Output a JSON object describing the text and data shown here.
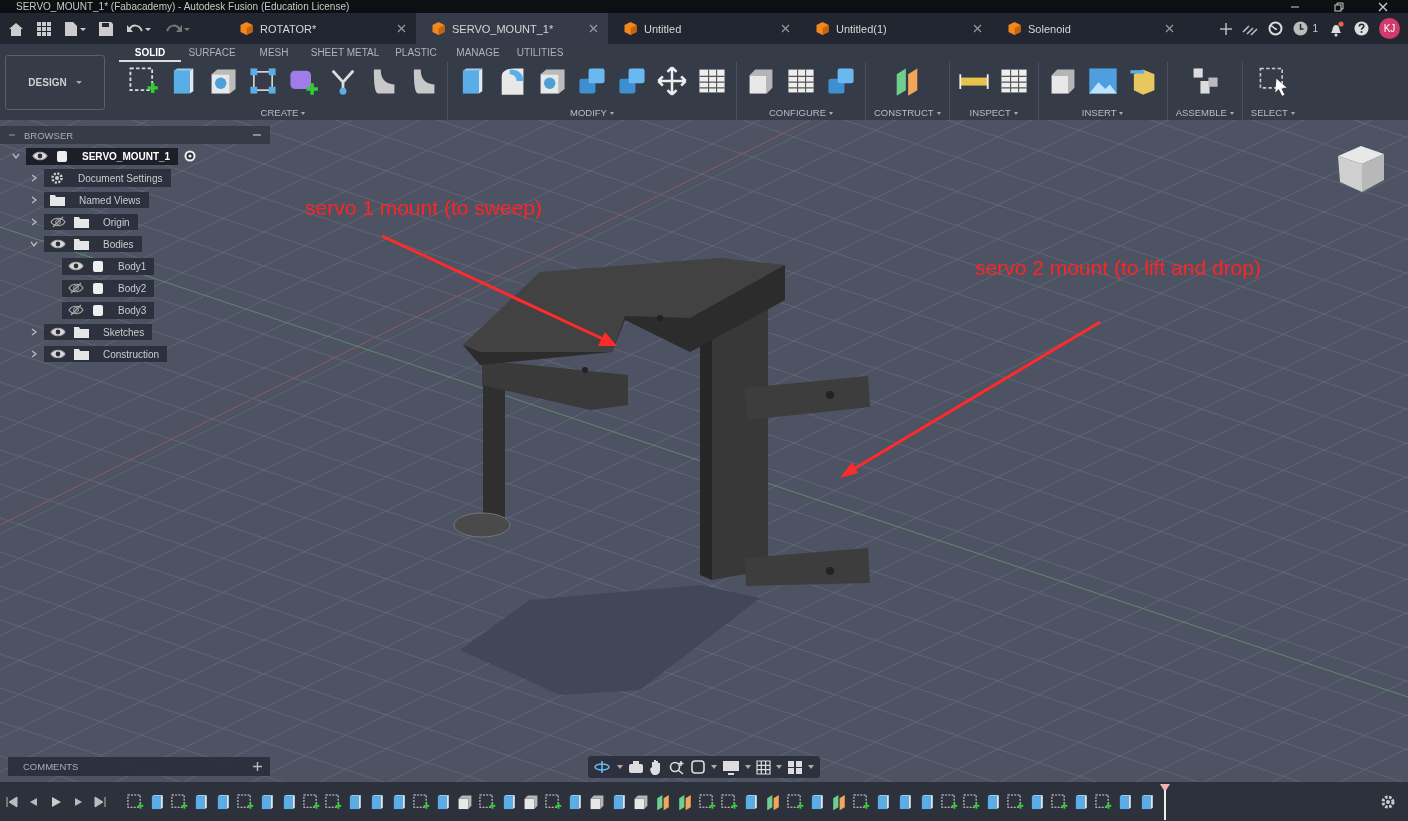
{
  "window": {
    "title": "SERVO_MOUNT_1* (Fabacademy) - Autodesk Fusion (Education License)"
  },
  "document_tabs": [
    {
      "label": "ROTATOR*",
      "selected": false
    },
    {
      "label": "SERVO_MOUNT_1*",
      "selected": true
    },
    {
      "label": "Untitled",
      "selected": false
    },
    {
      "label": "Untitled(1)",
      "selected": false
    },
    {
      "label": "Solenoid",
      "selected": false
    }
  ],
  "header": {
    "job_count": "1",
    "notification": true,
    "avatar": "KJ"
  },
  "workspace": {
    "label": "DESIGN"
  },
  "toolbar_tabs": [
    {
      "label": "SOLID",
      "selected": true
    },
    {
      "label": "SURFACE",
      "selected": false
    },
    {
      "label": "MESH",
      "selected": false
    },
    {
      "label": "SHEET METAL",
      "selected": false
    },
    {
      "label": "PLASTIC",
      "selected": false
    },
    {
      "label": "MANAGE",
      "selected": false
    },
    {
      "label": "UTILITIES",
      "selected": false
    }
  ],
  "tool_groups": [
    {
      "label": "CREATE",
      "tools": [
        {
          "kind": "sketch"
        },
        {
          "kind": "box"
        },
        {
          "kind": "hole"
        },
        {
          "kind": "pattern"
        },
        {
          "kind": "form"
        },
        {
          "kind": "branch"
        },
        {
          "kind": "curve"
        },
        {
          "kind": "curve"
        }
      ]
    },
    {
      "label": "MODIFY",
      "tools": [
        {
          "kind": "box"
        },
        {
          "kind": "fillet"
        },
        {
          "kind": "hole"
        },
        {
          "kind": "stack"
        },
        {
          "kind": "stack"
        },
        {
          "kind": "move"
        },
        {
          "kind": "table"
        }
      ]
    },
    {
      "label": "CONFIGURE",
      "tools": [
        {
          "kind": "cube"
        },
        {
          "kind": "table"
        },
        {
          "kind": "stack"
        }
      ]
    },
    {
      "label": "CONSTRUCT",
      "tools": [
        {
          "kind": "plane"
        }
      ]
    },
    {
      "label": "INSPECT",
      "tools": [
        {
          "kind": "ruler"
        },
        {
          "kind": "table"
        }
      ]
    },
    {
      "label": "INSERT",
      "tools": [
        {
          "kind": "cube"
        },
        {
          "kind": "image"
        },
        {
          "kind": "package"
        }
      ]
    },
    {
      "label": "ASSEMBLE",
      "tools": [
        {
          "kind": "blocks"
        }
      ]
    },
    {
      "label": "SELECT",
      "tools": [
        {
          "kind": "select"
        }
      ]
    }
  ],
  "browser": {
    "title": "BROWSER",
    "items": [
      {
        "label": "SERVO_MOUNT_1",
        "kind": "component",
        "expanded": true,
        "visible": true,
        "active": true,
        "children": [
          {
            "label": "Document Settings",
            "kind": "settings",
            "expanded": false
          },
          {
            "label": "Named Views",
            "kind": "folder",
            "expanded": false
          },
          {
            "label": "Origin",
            "kind": "folder",
            "expanded": false,
            "visible": false
          },
          {
            "label": "Bodies",
            "kind": "folder",
            "expanded": true,
            "visible": true,
            "children": [
              {
                "label": "Body1",
                "kind": "body",
                "visible": true
              },
              {
                "label": "Body2",
                "kind": "body",
                "visible": false
              },
              {
                "label": "Body3",
                "kind": "body",
                "visible": false
              }
            ]
          },
          {
            "label": "Sketches",
            "kind": "folder",
            "expanded": false,
            "visible": true
          },
          {
            "label": "Construction",
            "kind": "folder",
            "expanded": false,
            "visible": true
          }
        ]
      }
    ]
  },
  "annotations": [
    {
      "text": "servo 1 mount (to sweep)"
    },
    {
      "text": "servo 2 mount (to lift and drop)"
    }
  ],
  "comments": {
    "title": "COMMENTS"
  },
  "timeline": {
    "features": [
      {
        "kind": "sketch"
      },
      {
        "kind": "box"
      },
      {
        "kind": "sketch"
      },
      {
        "kind": "box"
      },
      {
        "kind": "box"
      },
      {
        "kind": "sketch"
      },
      {
        "kind": "box"
      },
      {
        "kind": "box"
      },
      {
        "kind": "sketch"
      },
      {
        "kind": "sketch"
      },
      {
        "kind": "box"
      },
      {
        "kind": "box"
      },
      {
        "kind": "box"
      },
      {
        "kind": "sketch"
      },
      {
        "kind": "box"
      },
      {
        "kind": "cube"
      },
      {
        "kind": "sketch"
      },
      {
        "kind": "box"
      },
      {
        "kind": "cube"
      },
      {
        "kind": "sketch"
      },
      {
        "kind": "box"
      },
      {
        "kind": "cube"
      },
      {
        "kind": "box"
      },
      {
        "kind": "cube"
      },
      {
        "kind": "plane"
      },
      {
        "kind": "plane"
      },
      {
        "kind": "sketch"
      },
      {
        "kind": "sketch"
      },
      {
        "kind": "box"
      },
      {
        "kind": "plane"
      },
      {
        "kind": "sketch"
      },
      {
        "kind": "box"
      },
      {
        "kind": "plane"
      },
      {
        "kind": "sketch"
      },
      {
        "kind": "box"
      },
      {
        "kind": "box"
      },
      {
        "kind": "box"
      },
      {
        "kind": "sketch"
      },
      {
        "kind": "sketch"
      },
      {
        "kind": "box"
      },
      {
        "kind": "sketch"
      },
      {
        "kind": "box"
      },
      {
        "kind": "sketch"
      },
      {
        "kind": "box"
      },
      {
        "kind": "sketch"
      },
      {
        "kind": "box"
      },
      {
        "kind": "box"
      }
    ]
  }
}
